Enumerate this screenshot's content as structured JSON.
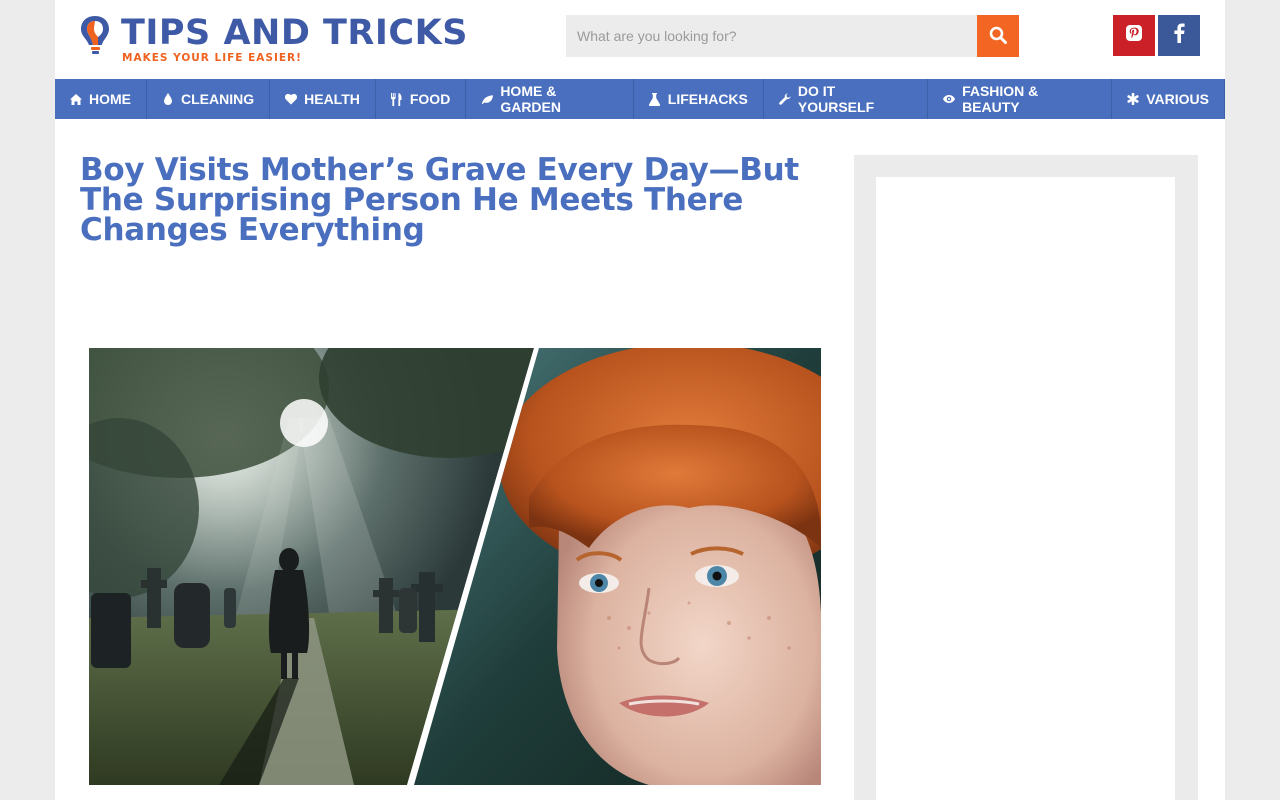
{
  "site": {
    "logo_title": "TIPS AND TRICKS",
    "logo_tagline": "MAKES YOUR LIFE EASIER!",
    "colors": {
      "brand_blue": "#3e5aa6",
      "nav_blue": "#4a6fbe",
      "accent_orange": "#f26522",
      "pinterest": "#cb2027",
      "facebook": "#3b5998"
    }
  },
  "search": {
    "placeholder": "What are you looking for?",
    "value": "",
    "button_icon": "search-icon"
  },
  "social": [
    {
      "name": "Pinterest",
      "icon": "pinterest-icon"
    },
    {
      "name": "Facebook",
      "icon": "facebook-icon"
    }
  ],
  "nav": {
    "items": [
      {
        "label": "HOME",
        "icon": "home-icon"
      },
      {
        "label": "CLEANING",
        "icon": "droplet-icon"
      },
      {
        "label": "HEALTH",
        "icon": "heart-icon"
      },
      {
        "label": "FOOD",
        "icon": "cutlery-icon"
      },
      {
        "label": "HOME & GARDEN",
        "icon": "leaf-icon"
      },
      {
        "label": "LIFEHACKS",
        "icon": "flask-icon"
      },
      {
        "label": "DO IT YOURSELF",
        "icon": "wrench-icon"
      },
      {
        "label": "FASHION & BEAUTY",
        "icon": "eye-icon"
      },
      {
        "label": "VARIOUS",
        "icon": "asterisk-icon"
      }
    ]
  },
  "article": {
    "title": "Boy Visits Mother’s Grave Every Day—But The Surprising Person He Meets There Changes Everything"
  }
}
